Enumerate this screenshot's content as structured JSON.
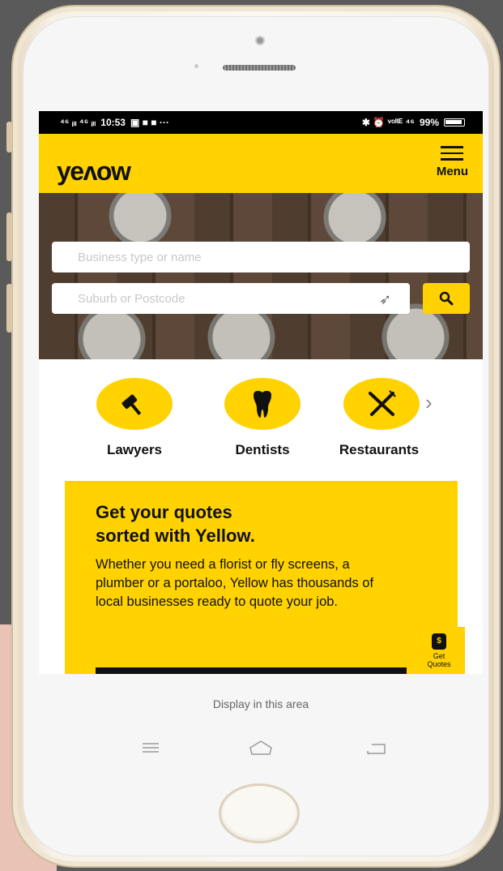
{
  "status_bar": {
    "signal": "⁴⁶ ᵢₗₗ ⁴⁶ ᵢₗₗ",
    "time": "10:53",
    "notifications": "▣ ■ ■ ···",
    "right_icons": "✱ ⏰ ᵛᵒˡᵗᴱ ⁴⁶",
    "battery": "99%"
  },
  "header": {
    "logo": "yeʌow",
    "menu_label": "Menu"
  },
  "search": {
    "business_placeholder": "Business type or name",
    "location_placeholder": "Suburb or Postcode"
  },
  "categories": [
    {
      "label": "Lawyers",
      "icon": "gavel-icon"
    },
    {
      "label": "Dentists",
      "icon": "tooth-icon"
    },
    {
      "label": "Restaurants",
      "icon": "fork-knife-icon"
    }
  ],
  "promo": {
    "title_line1": "Get your quotes",
    "title_line2": "sorted with Yellow.",
    "body": "Whether you need a florist or fly screens, a plumber or a portaloo, Yellow has thousands of local businesses ready to quote your job."
  },
  "get_quotes": {
    "label_line1": "Get",
    "label_line2": "Quotes"
  },
  "device": {
    "display_area_text": "Display in this area"
  },
  "colors": {
    "brand_yellow": "#ffd200",
    "text_dark": "#111111"
  }
}
